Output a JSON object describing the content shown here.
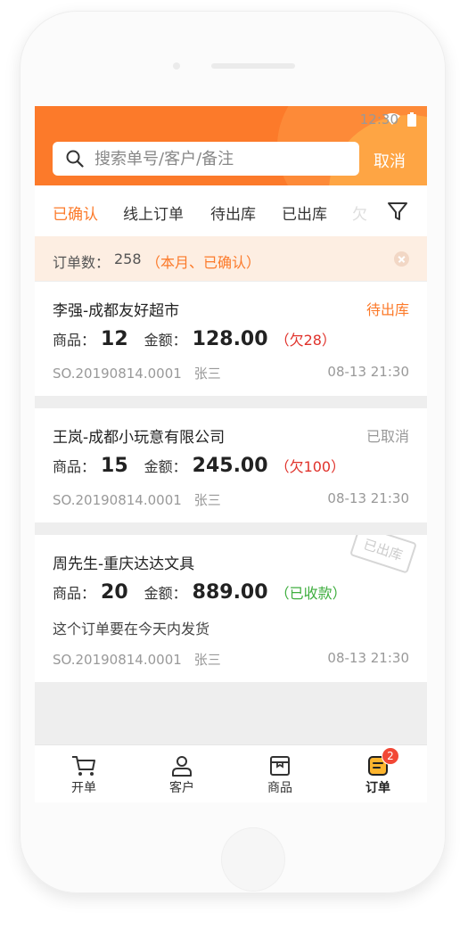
{
  "status_bar": {
    "time": "12:30"
  },
  "search": {
    "placeholder": "搜索单号/客户/备注",
    "cancel_label": "取消"
  },
  "tabs": [
    {
      "label": "已确认",
      "active": true
    },
    {
      "label": "线上订单"
    },
    {
      "label": "待出库"
    },
    {
      "label": "已出库"
    },
    {
      "label": "欠"
    }
  ],
  "summary": {
    "label": "订单数：",
    "count": "258",
    "filter_tag": "（本月、已确认）"
  },
  "orders": [
    {
      "customer": "李强-成都友好超市",
      "status": "待出库",
      "status_color": "#fc7a2a",
      "goods_label": "商品：",
      "goods": "12",
      "amount_label": "金额：",
      "amount": "128.00",
      "debt": "（欠28）",
      "debt_color": "#e0322b",
      "order_no": "SO.20190814.0001",
      "clerk": "张三",
      "time": "08-13 21:30"
    },
    {
      "customer": "王岚-成都小玩意有限公司",
      "status": "已取消",
      "status_color": "#999999",
      "goods_label": "商品：",
      "goods": "15",
      "amount_label": "金额：",
      "amount": "245.00",
      "debt": "（欠100）",
      "debt_color": "#e0322b",
      "order_no": "SO.20190814.0001",
      "clerk": "张三",
      "time": "08-13 21:30"
    },
    {
      "customer": "周先生-重庆达达文具",
      "stamp": "已出库",
      "goods_label": "商品：",
      "goods": "20",
      "amount_label": "金额：",
      "amount": "889.00",
      "debt": "（已收款）",
      "debt_color": "#3fae3f",
      "note": "这个订单要在今天内发货",
      "order_no": "SO.20190814.0001",
      "clerk": "张三",
      "time": "08-13 21:30"
    }
  ],
  "bottom_nav": [
    {
      "label": "开单",
      "icon": "cart-icon"
    },
    {
      "label": "客户",
      "icon": "person-icon"
    },
    {
      "label": "商品",
      "icon": "box-icon"
    },
    {
      "label": "订单",
      "icon": "order-icon",
      "active": true,
      "badge": "2"
    }
  ],
  "colors": {
    "brand": "#fc7a2a",
    "debt": "#e0322b",
    "paid": "#3fae3f"
  }
}
